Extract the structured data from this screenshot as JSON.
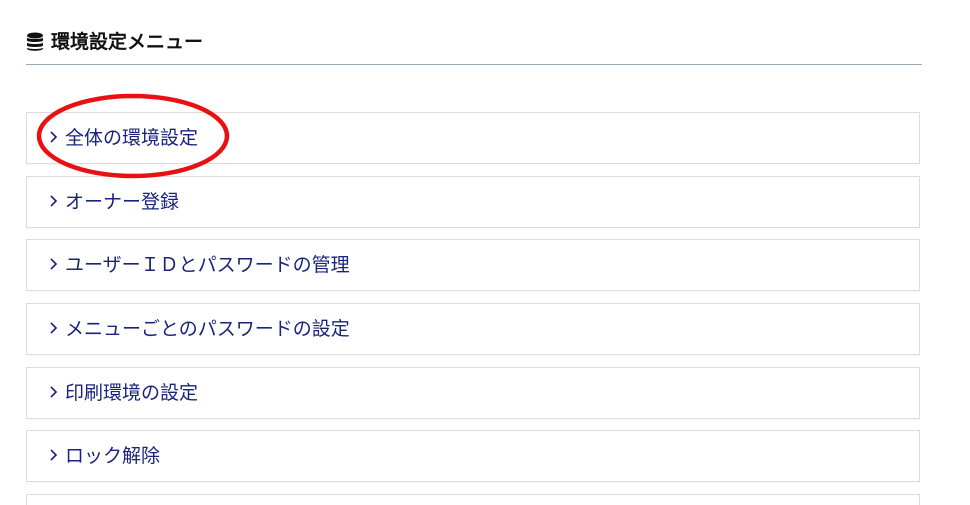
{
  "header": {
    "title": "環境設定メニュー",
    "icon": "database-icon"
  },
  "menu": {
    "items": [
      {
        "label": "全体の環境設定"
      },
      {
        "label": "オーナー登録"
      },
      {
        "label": "ユーザーＩＤとパスワードの管理"
      },
      {
        "label": "メニューごとのパスワードの設定"
      },
      {
        "label": "印刷環境の設定"
      },
      {
        "label": "ロック解除"
      },
      {
        "label": ""
      }
    ],
    "chevron_icon": "chevron-right-icon"
  },
  "annotation": {
    "shape": "ellipse",
    "color": "#e81010",
    "target": "全体の環境設定"
  },
  "colors": {
    "label_text": "#1a237e",
    "header_rule": "#9aa8b8",
    "item_border": "#dcdcdc"
  }
}
